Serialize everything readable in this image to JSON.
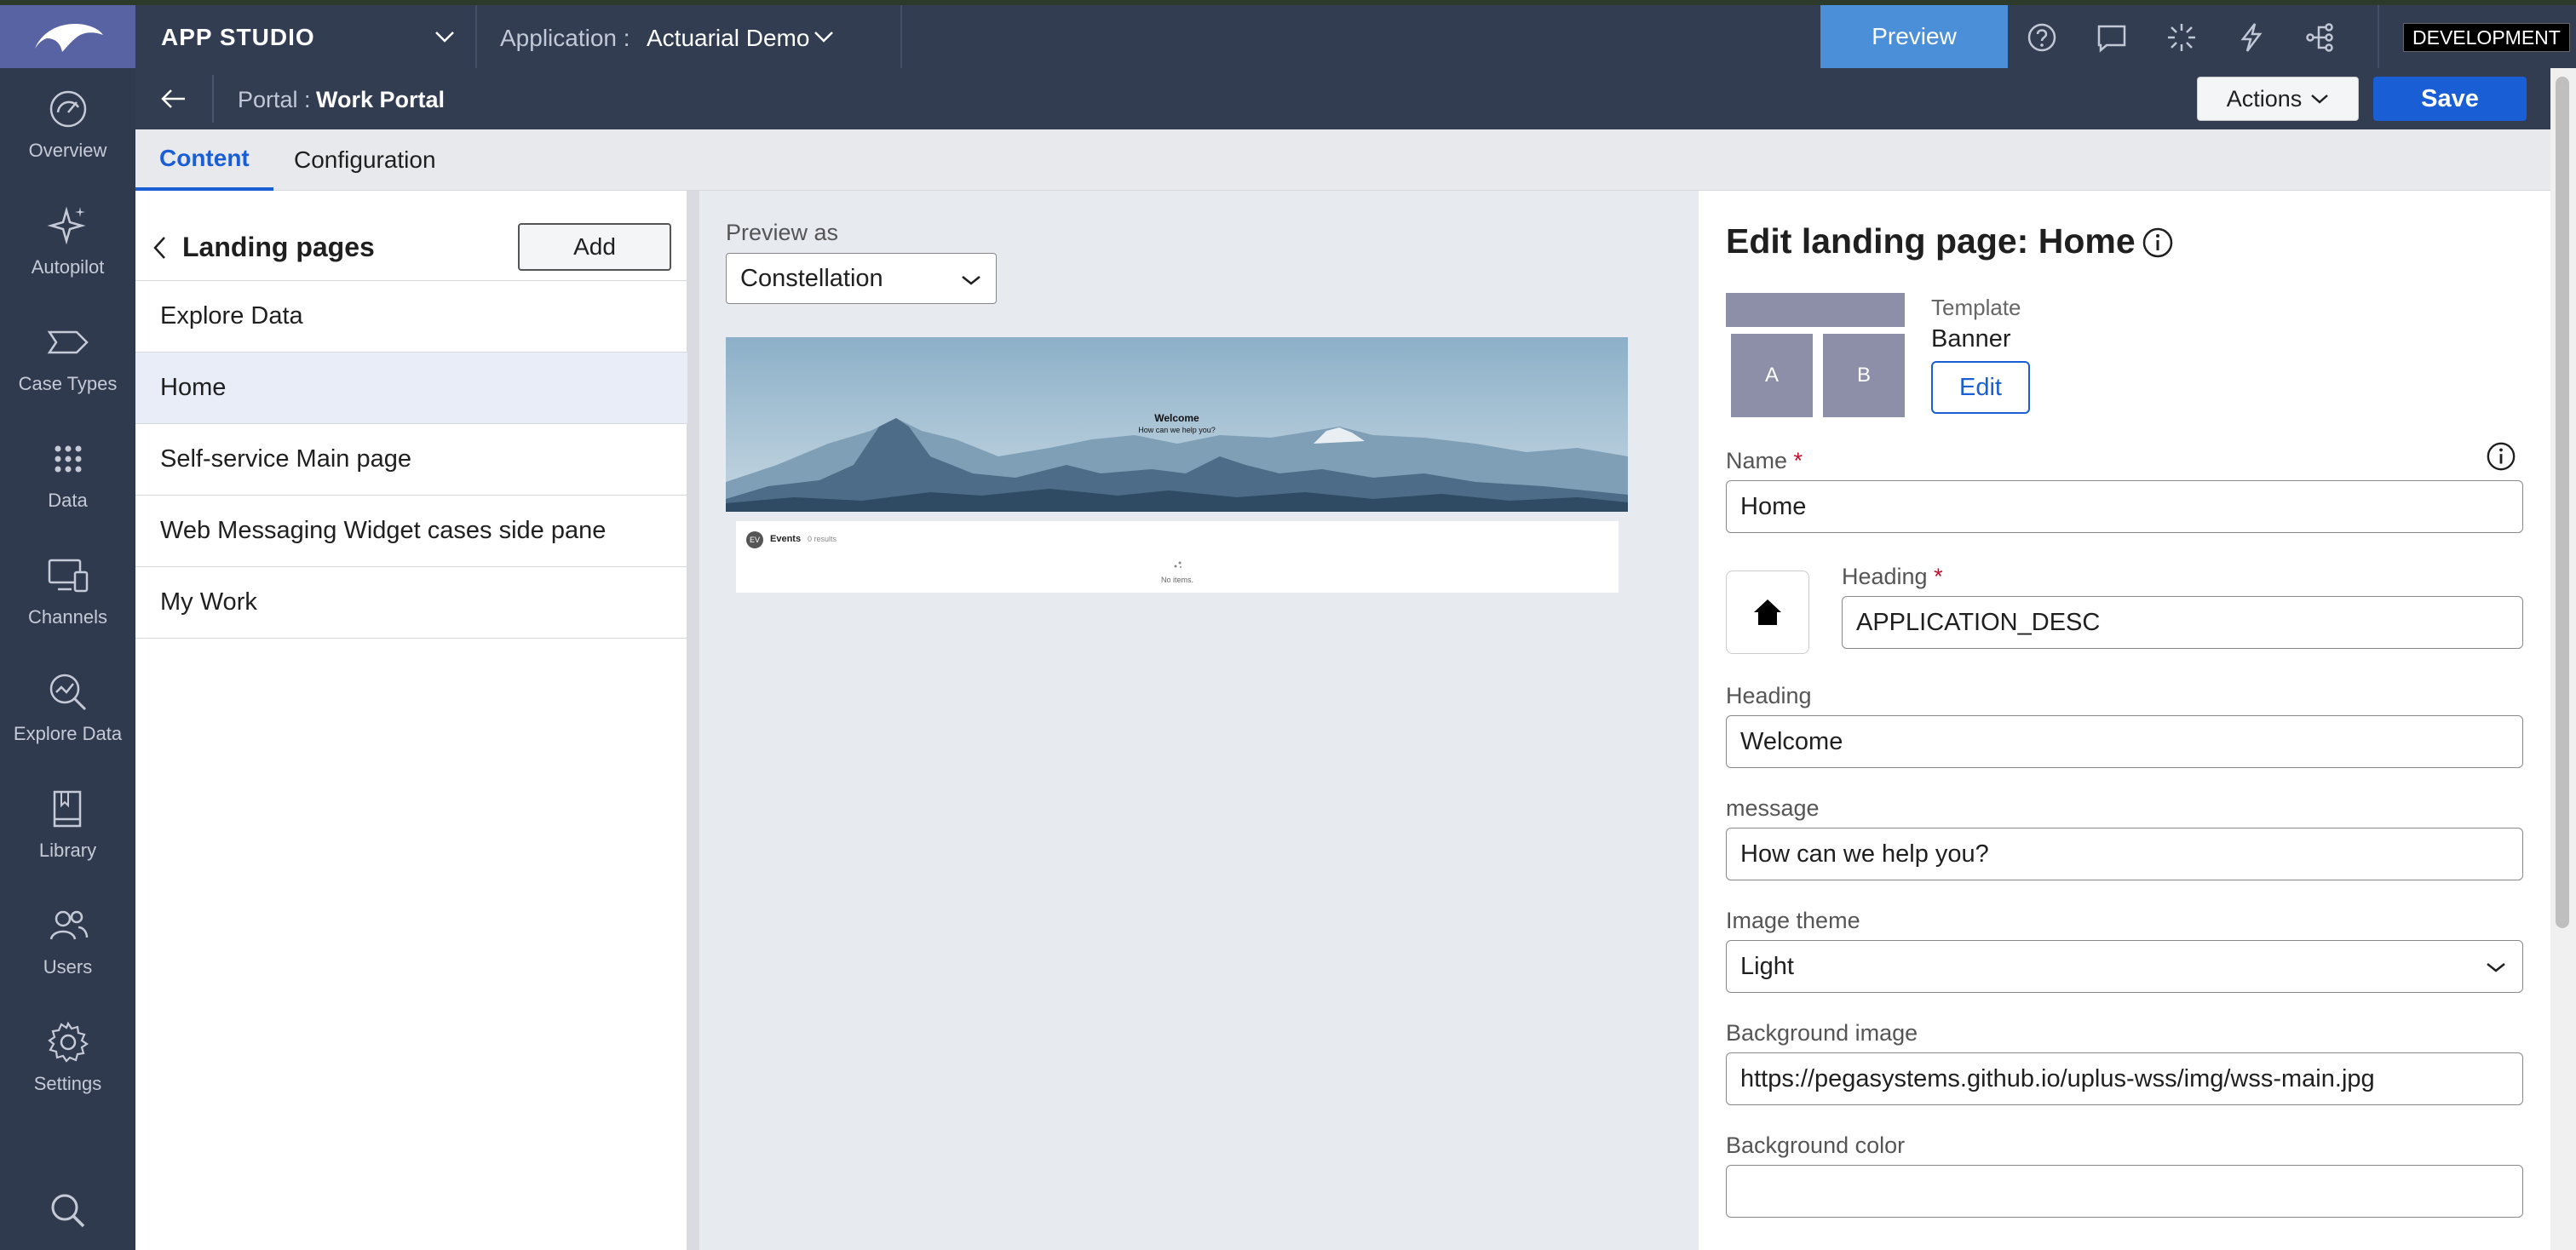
{
  "header": {
    "app_studio": "APP STUDIO",
    "application_label": "Application :",
    "application_name": "Actuarial Demo",
    "preview_label": "Preview",
    "environment": "DEVELOPMENT"
  },
  "rail": {
    "items": [
      {
        "label": "Overview",
        "icon": "gauge-icon"
      },
      {
        "label": "Autopilot",
        "icon": "sparkle-icon"
      },
      {
        "label": "Case Types",
        "icon": "case-type-icon"
      },
      {
        "label": "Data",
        "icon": "data-dots-icon"
      },
      {
        "label": "Channels",
        "icon": "channels-icon"
      },
      {
        "label": "Explore Data",
        "icon": "explore-icon"
      },
      {
        "label": "Library",
        "icon": "book-icon"
      },
      {
        "label": "Users",
        "icon": "users-icon"
      },
      {
        "label": "Settings",
        "icon": "gear-icon"
      }
    ]
  },
  "subheader": {
    "portal_label": "Portal :",
    "portal_name": "Work Portal",
    "actions_label": "Actions",
    "save_label": "Save"
  },
  "tabs": [
    {
      "label": "Content",
      "active": true
    },
    {
      "label": "Configuration",
      "active": false
    }
  ],
  "landing_pages": {
    "title": "Landing pages",
    "add_label": "Add",
    "items": [
      {
        "label": "Explore Data",
        "selected": false
      },
      {
        "label": "Home",
        "selected": true
      },
      {
        "label": "Self-service Main page",
        "selected": false
      },
      {
        "label": "Web Messaging Widget cases side pane",
        "selected": false
      },
      {
        "label": "My Work",
        "selected": false
      }
    ]
  },
  "preview": {
    "preview_as_label": "Preview as",
    "preview_as_value": "Constellation",
    "banner_heading": "Welcome",
    "banner_message": "How can we help you?",
    "events_avatar": "EV",
    "events_title": "Events",
    "events_results": "0 results",
    "events_empty": "No items."
  },
  "edit": {
    "title": "Edit landing page: Home",
    "template_label": "Template",
    "template_value": "Banner",
    "template_cell_a": "A",
    "template_cell_b": "B",
    "edit_label": "Edit",
    "name_label": "Name",
    "name_value": "Home",
    "icon_heading_label": "Heading",
    "icon_heading_value": "APPLICATION_DESC",
    "heading_label": "Heading",
    "heading_value": "Welcome",
    "message_label": "message",
    "message_value": "How can we help you?",
    "image_theme_label": "Image theme",
    "image_theme_value": "Light",
    "bg_image_label": "Background image",
    "bg_image_value": "https://pegasystems.github.io/uplus-wss/img/wss-main.jpg",
    "bg_color_label": "Background color",
    "bg_color_value": "",
    "required_mark": "*"
  },
  "colors": {
    "rail": "#2f3a4e",
    "header": "#323d52",
    "logo_bg": "#5863a4",
    "accent": "#1a5ed6",
    "preview_button": "#4a8fd8"
  }
}
